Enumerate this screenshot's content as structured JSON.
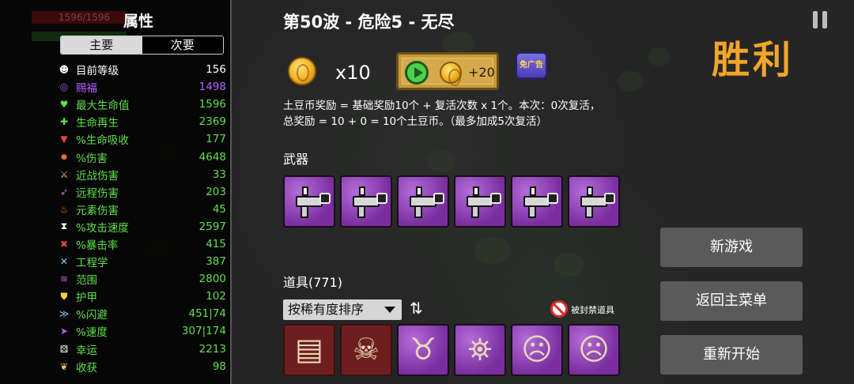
{
  "header": {
    "wave_title": "第50波 - 危险5 - 无尽",
    "victory": "胜利"
  },
  "reward": {
    "coin_multiplier": "x10",
    "ad_bonus": "+20",
    "ad_badge": "免广告",
    "description_line1": "土豆币奖励 = 基础奖励10个 + 复活次数 x 1个。本次：0次复活，",
    "description_line2": "总奖励 = 10 + 0 = 10个土豆币。（最多加成5次复活）"
  },
  "stats_panel": {
    "title": "属性",
    "hp_ghost": "1596/1596",
    "tabs": [
      {
        "label": "主要",
        "active": true
      },
      {
        "label": "次要",
        "active": false
      }
    ],
    "stats": [
      {
        "icon": "level-icon",
        "glyph": "☻",
        "color": "#ffffff",
        "icon_color": "#ffffff",
        "label": "目前等级",
        "value": "156"
      },
      {
        "icon": "eye-icon",
        "glyph": "◎",
        "color": "#b35cff",
        "icon_color": "#b35cff",
        "label": "赐福",
        "value": "1498"
      },
      {
        "icon": "heart-icon",
        "glyph": "♥",
        "color": "#5ee04b",
        "icon_color": "#5ee04b",
        "label": "最大生命值",
        "value": "1596"
      },
      {
        "icon": "regen-icon",
        "glyph": "✚",
        "color": "#5ee04b",
        "icon_color": "#5ee04b",
        "label": "生命再生",
        "value": "2369"
      },
      {
        "icon": "lifesteal-icon",
        "glyph": "▼",
        "color": "#5ee04b",
        "icon_color": "#e04545",
        "label": "%生命吸收",
        "value": "177"
      },
      {
        "icon": "damage-icon",
        "glyph": "✹",
        "color": "#5ee04b",
        "icon_color": "#e07a3a",
        "label": "%伤害",
        "value": "4648"
      },
      {
        "icon": "melee-icon",
        "glyph": "⚔",
        "color": "#5ee04b",
        "icon_color": "#e6c36e",
        "label": "近战伤害",
        "value": "33"
      },
      {
        "icon": "ranged-icon",
        "glyph": "➶",
        "color": "#5ee04b",
        "icon_color": "#d06ad0",
        "label": "远程伤害",
        "value": "203"
      },
      {
        "icon": "elemental-icon",
        "glyph": "♨",
        "color": "#5ee04b",
        "icon_color": "#ff7a2a",
        "label": "元素伤害",
        "value": "45"
      },
      {
        "icon": "hourglass-icon",
        "glyph": "⧗",
        "color": "#5ee04b",
        "icon_color": "#ffffff",
        "label": "%攻击速度",
        "value": "2597"
      },
      {
        "icon": "crit-icon",
        "glyph": "✖",
        "color": "#5ee04b",
        "icon_color": "#e04545",
        "label": "%暴击率",
        "value": "415"
      },
      {
        "icon": "engineering-icon",
        "glyph": "✕",
        "color": "#5ee04b",
        "icon_color": "#7ad0ff",
        "label": "工程学",
        "value": "387"
      },
      {
        "icon": "range-icon",
        "glyph": "≋",
        "color": "#5ee04b",
        "icon_color": "#c86ae0",
        "label": "范围",
        "value": "2800"
      },
      {
        "icon": "armor-icon",
        "glyph": "⛊",
        "color": "#5ee04b",
        "icon_color": "#ffd23a",
        "label": "护甲",
        "value": "102"
      },
      {
        "icon": "dodge-icon",
        "glyph": "≫",
        "color": "#5ee04b",
        "icon_color": "#7ad0ff",
        "label": "%闪避",
        "value": "451|74"
      },
      {
        "icon": "speed-icon",
        "glyph": "➤",
        "color": "#5ee04b",
        "icon_color": "#b35cff",
        "label": "%速度",
        "value": "307|174"
      },
      {
        "icon": "luck-icon",
        "glyph": "⚄",
        "color": "#5ee04b",
        "icon_color": "#ffffff",
        "label": "幸运",
        "value": "2213"
      },
      {
        "icon": "harvest-icon",
        "glyph": "❦",
        "color": "#5ee04b",
        "icon_color": "#e6c36e",
        "label": "收获",
        "value": "98"
      }
    ]
  },
  "weapons": {
    "label": "武器",
    "items": [
      "smg-icon",
      "smg-icon",
      "smg-icon",
      "smg-icon",
      "smg-icon",
      "smg-icon"
    ]
  },
  "items": {
    "label": "道具(771)",
    "sort_label": "按稀有度排序",
    "banned_label": "被封禁道具",
    "slots": [
      {
        "name": "hay-bale-icon",
        "style": "red"
      },
      {
        "name": "skull-flag-icon",
        "style": "red"
      },
      {
        "name": "horned-skull-icon",
        "style": "purple"
      },
      {
        "name": "lantern-icon",
        "style": "purple"
      },
      {
        "name": "hooded-face-icon",
        "style": "purple"
      },
      {
        "name": "hooded-face-icon",
        "style": "purple"
      }
    ]
  },
  "menu": {
    "new_game": "新游戏",
    "main_menu": "返回主菜单",
    "restart": "重新开始"
  }
}
